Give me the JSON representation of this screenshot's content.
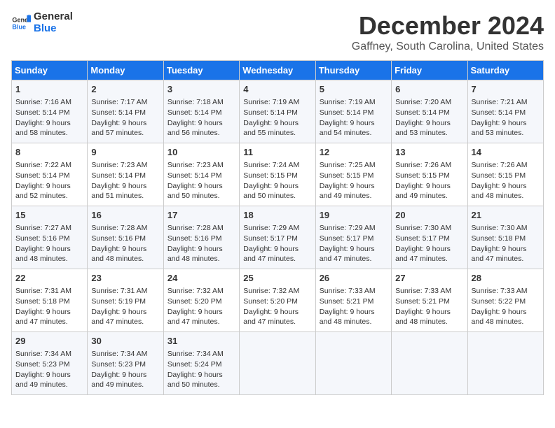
{
  "logo": {
    "line1": "General",
    "line2": "Blue"
  },
  "title": "December 2024",
  "subtitle": "Gaffney, South Carolina, United States",
  "days_of_week": [
    "Sunday",
    "Monday",
    "Tuesday",
    "Wednesday",
    "Thursday",
    "Friday",
    "Saturday"
  ],
  "weeks": [
    [
      {
        "day": "1",
        "sunrise": "Sunrise: 7:16 AM",
        "sunset": "Sunset: 5:14 PM",
        "daylight": "Daylight: 9 hours and 58 minutes."
      },
      {
        "day": "2",
        "sunrise": "Sunrise: 7:17 AM",
        "sunset": "Sunset: 5:14 PM",
        "daylight": "Daylight: 9 hours and 57 minutes."
      },
      {
        "day": "3",
        "sunrise": "Sunrise: 7:18 AM",
        "sunset": "Sunset: 5:14 PM",
        "daylight": "Daylight: 9 hours and 56 minutes."
      },
      {
        "day": "4",
        "sunrise": "Sunrise: 7:19 AM",
        "sunset": "Sunset: 5:14 PM",
        "daylight": "Daylight: 9 hours and 55 minutes."
      },
      {
        "day": "5",
        "sunrise": "Sunrise: 7:19 AM",
        "sunset": "Sunset: 5:14 PM",
        "daylight": "Daylight: 9 hours and 54 minutes."
      },
      {
        "day": "6",
        "sunrise": "Sunrise: 7:20 AM",
        "sunset": "Sunset: 5:14 PM",
        "daylight": "Daylight: 9 hours and 53 minutes."
      },
      {
        "day": "7",
        "sunrise": "Sunrise: 7:21 AM",
        "sunset": "Sunset: 5:14 PM",
        "daylight": "Daylight: 9 hours and 53 minutes."
      }
    ],
    [
      {
        "day": "8",
        "sunrise": "Sunrise: 7:22 AM",
        "sunset": "Sunset: 5:14 PM",
        "daylight": "Daylight: 9 hours and 52 minutes."
      },
      {
        "day": "9",
        "sunrise": "Sunrise: 7:23 AM",
        "sunset": "Sunset: 5:14 PM",
        "daylight": "Daylight: 9 hours and 51 minutes."
      },
      {
        "day": "10",
        "sunrise": "Sunrise: 7:23 AM",
        "sunset": "Sunset: 5:14 PM",
        "daylight": "Daylight: 9 hours and 50 minutes."
      },
      {
        "day": "11",
        "sunrise": "Sunrise: 7:24 AM",
        "sunset": "Sunset: 5:15 PM",
        "daylight": "Daylight: 9 hours and 50 minutes."
      },
      {
        "day": "12",
        "sunrise": "Sunrise: 7:25 AM",
        "sunset": "Sunset: 5:15 PM",
        "daylight": "Daylight: 9 hours and 49 minutes."
      },
      {
        "day": "13",
        "sunrise": "Sunrise: 7:26 AM",
        "sunset": "Sunset: 5:15 PM",
        "daylight": "Daylight: 9 hours and 49 minutes."
      },
      {
        "day": "14",
        "sunrise": "Sunrise: 7:26 AM",
        "sunset": "Sunset: 5:15 PM",
        "daylight": "Daylight: 9 hours and 48 minutes."
      }
    ],
    [
      {
        "day": "15",
        "sunrise": "Sunrise: 7:27 AM",
        "sunset": "Sunset: 5:16 PM",
        "daylight": "Daylight: 9 hours and 48 minutes."
      },
      {
        "day": "16",
        "sunrise": "Sunrise: 7:28 AM",
        "sunset": "Sunset: 5:16 PM",
        "daylight": "Daylight: 9 hours and 48 minutes."
      },
      {
        "day": "17",
        "sunrise": "Sunrise: 7:28 AM",
        "sunset": "Sunset: 5:16 PM",
        "daylight": "Daylight: 9 hours and 48 minutes."
      },
      {
        "day": "18",
        "sunrise": "Sunrise: 7:29 AM",
        "sunset": "Sunset: 5:17 PM",
        "daylight": "Daylight: 9 hours and 47 minutes."
      },
      {
        "day": "19",
        "sunrise": "Sunrise: 7:29 AM",
        "sunset": "Sunset: 5:17 PM",
        "daylight": "Daylight: 9 hours and 47 minutes."
      },
      {
        "day": "20",
        "sunrise": "Sunrise: 7:30 AM",
        "sunset": "Sunset: 5:17 PM",
        "daylight": "Daylight: 9 hours and 47 minutes."
      },
      {
        "day": "21",
        "sunrise": "Sunrise: 7:30 AM",
        "sunset": "Sunset: 5:18 PM",
        "daylight": "Daylight: 9 hours and 47 minutes."
      }
    ],
    [
      {
        "day": "22",
        "sunrise": "Sunrise: 7:31 AM",
        "sunset": "Sunset: 5:18 PM",
        "daylight": "Daylight: 9 hours and 47 minutes."
      },
      {
        "day": "23",
        "sunrise": "Sunrise: 7:31 AM",
        "sunset": "Sunset: 5:19 PM",
        "daylight": "Daylight: 9 hours and 47 minutes."
      },
      {
        "day": "24",
        "sunrise": "Sunrise: 7:32 AM",
        "sunset": "Sunset: 5:20 PM",
        "daylight": "Daylight: 9 hours and 47 minutes."
      },
      {
        "day": "25",
        "sunrise": "Sunrise: 7:32 AM",
        "sunset": "Sunset: 5:20 PM",
        "daylight": "Daylight: 9 hours and 47 minutes."
      },
      {
        "day": "26",
        "sunrise": "Sunrise: 7:33 AM",
        "sunset": "Sunset: 5:21 PM",
        "daylight": "Daylight: 9 hours and 48 minutes."
      },
      {
        "day": "27",
        "sunrise": "Sunrise: 7:33 AM",
        "sunset": "Sunset: 5:21 PM",
        "daylight": "Daylight: 9 hours and 48 minutes."
      },
      {
        "day": "28",
        "sunrise": "Sunrise: 7:33 AM",
        "sunset": "Sunset: 5:22 PM",
        "daylight": "Daylight: 9 hours and 48 minutes."
      }
    ],
    [
      {
        "day": "29",
        "sunrise": "Sunrise: 7:34 AM",
        "sunset": "Sunset: 5:23 PM",
        "daylight": "Daylight: 9 hours and 49 minutes."
      },
      {
        "day": "30",
        "sunrise": "Sunrise: 7:34 AM",
        "sunset": "Sunset: 5:23 PM",
        "daylight": "Daylight: 9 hours and 49 minutes."
      },
      {
        "day": "31",
        "sunrise": "Sunrise: 7:34 AM",
        "sunset": "Sunset: 5:24 PM",
        "daylight": "Daylight: 9 hours and 50 minutes."
      },
      {
        "day": "",
        "sunrise": "",
        "sunset": "",
        "daylight": ""
      },
      {
        "day": "",
        "sunrise": "",
        "sunset": "",
        "daylight": ""
      },
      {
        "day": "",
        "sunrise": "",
        "sunset": "",
        "daylight": ""
      },
      {
        "day": "",
        "sunrise": "",
        "sunset": "",
        "daylight": ""
      }
    ]
  ]
}
